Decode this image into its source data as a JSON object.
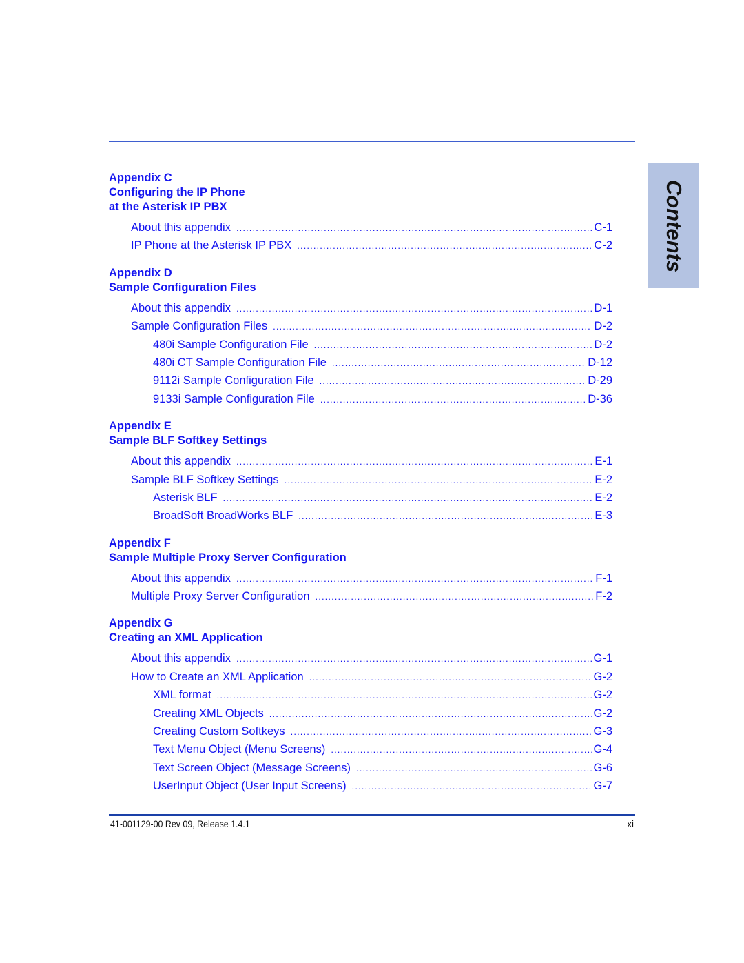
{
  "side_tab": {
    "label": "Contents"
  },
  "colors": {
    "link_blue": "#1414f0",
    "rule_top": "#3f5fcf",
    "rule_bottom": "#1a40a8",
    "tab_background": "#b4c3e2"
  },
  "appendices": [
    {
      "heading_lines": [
        "Appendix C",
        "Configuring the IP Phone",
        "at the Asterisk IP PBX"
      ],
      "entries": [
        {
          "level": 1,
          "title": "About this appendix",
          "page": "C-1"
        },
        {
          "level": 1,
          "title": "IP Phone at the Asterisk IP PBX",
          "page": "C-2"
        }
      ]
    },
    {
      "heading_lines": [
        "Appendix D",
        "Sample Configuration Files"
      ],
      "entries": [
        {
          "level": 1,
          "title": "About this appendix",
          "page": "D-1"
        },
        {
          "level": 1,
          "title": "Sample Configuration Files",
          "page": "D-2"
        },
        {
          "level": 2,
          "title": "480i Sample Configuration File",
          "page": "D-2"
        },
        {
          "level": 2,
          "title": "480i CT Sample Configuration File",
          "page": "D-12"
        },
        {
          "level": 2,
          "title": "9112i Sample Configuration File",
          "page": "D-29"
        },
        {
          "level": 2,
          "title": "9133i Sample Configuration File",
          "page": "D-36"
        }
      ]
    },
    {
      "heading_lines": [
        "Appendix E",
        "Sample BLF Softkey Settings"
      ],
      "entries": [
        {
          "level": 1,
          "title": "About this appendix",
          "page": "E-1"
        },
        {
          "level": 1,
          "title": "Sample BLF Softkey Settings",
          "page": "E-2"
        },
        {
          "level": 2,
          "title": "Asterisk BLF",
          "page": "E-2"
        },
        {
          "level": 2,
          "title": "BroadSoft BroadWorks BLF",
          "page": "E-3"
        }
      ]
    },
    {
      "heading_lines": [
        "Appendix F",
        "Sample Multiple Proxy Server Configuration"
      ],
      "entries": [
        {
          "level": 1,
          "title": "About this appendix",
          "page": "F-1"
        },
        {
          "level": 1,
          "title": "Multiple Proxy Server Configuration",
          "page": "F-2"
        }
      ]
    },
    {
      "heading_lines": [
        "Appendix G",
        "Creating an XML Application"
      ],
      "entries": [
        {
          "level": 1,
          "title": "About this appendix",
          "page": "G-1"
        },
        {
          "level": 1,
          "title": "How to Create an XML Application",
          "page": "G-2"
        },
        {
          "level": 2,
          "title": "XML format",
          "page": "G-2"
        },
        {
          "level": 2,
          "title": "Creating XML Objects",
          "page": "G-2"
        },
        {
          "level": 2,
          "title": "Creating Custom Softkeys",
          "page": "G-3"
        },
        {
          "level": 2,
          "title": "Text Menu Object (Menu Screens)",
          "page": "G-4"
        },
        {
          "level": 2,
          "title": "Text Screen Object (Message Screens)",
          "page": "G-6"
        },
        {
          "level": 2,
          "title": "UserInput Object (User Input Screens)",
          "page": "G-7"
        }
      ]
    }
  ],
  "footer": {
    "document_id": "41-001129-00 Rev 09, Release 1.4.1",
    "page_number": "xi"
  }
}
